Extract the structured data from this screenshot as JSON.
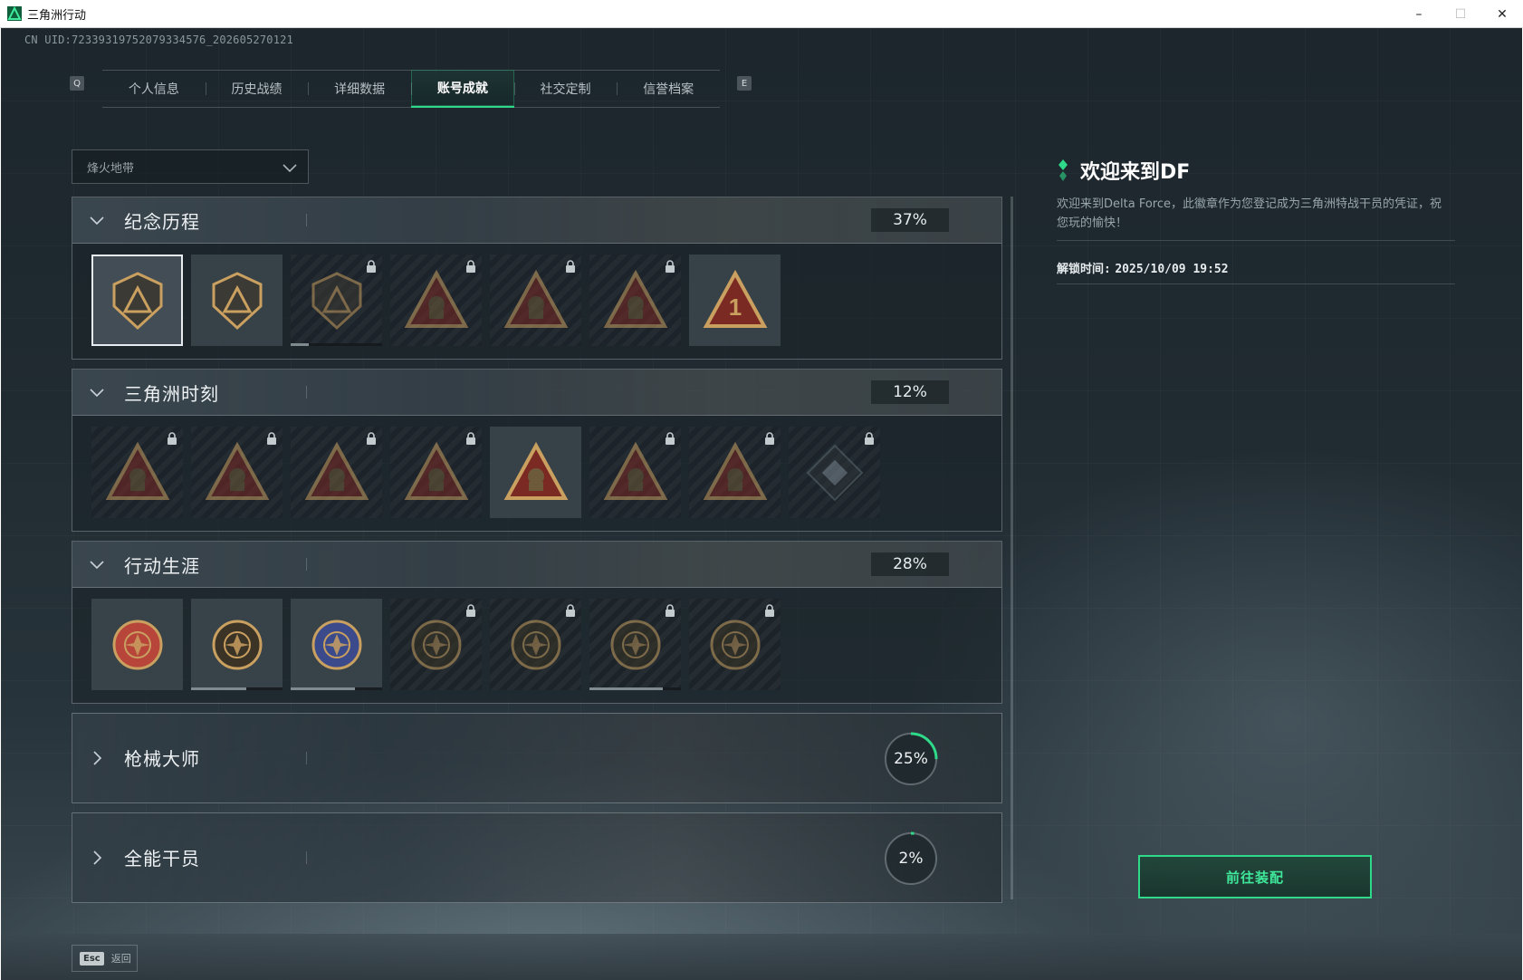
{
  "window": {
    "title": "三角洲行动",
    "controls": [
      "minimize",
      "maximize",
      "close"
    ]
  },
  "uid": "CN UID:7233931975207933457​6_202605270121",
  "tabs": {
    "left_key": "Q",
    "right_key": "E",
    "items": [
      {
        "label": "个人信息",
        "active": false
      },
      {
        "label": "历史战绩",
        "active": false
      },
      {
        "label": "详细数据",
        "active": false
      },
      {
        "label": "账号成就",
        "active": true
      },
      {
        "label": "社交定制",
        "active": false
      },
      {
        "label": "信誉档案",
        "active": false
      }
    ]
  },
  "mode_select": {
    "value": "烽火地带"
  },
  "sections": [
    {
      "title": "纪念历程",
      "percent": "37%",
      "expanded": true,
      "medals": [
        {
          "icon": "delta-triangle-shield-icon",
          "locked": false,
          "selected": true,
          "progress": 1
        },
        {
          "icon": "helicopter-shield-icon",
          "locked": false,
          "selected": false,
          "progress": 1
        },
        {
          "icon": "hex-shield-icon",
          "locked": true,
          "selected": false,
          "progress": 0.2
        },
        {
          "icon": "soldier-triangle-icon",
          "locked": true,
          "selected": false,
          "progress": 0
        },
        {
          "icon": "hooded-figure-triangle-icon",
          "locked": true,
          "selected": false,
          "progress": 0
        },
        {
          "icon": "crossed-rifles-triangle-icon",
          "locked": true,
          "selected": false,
          "progress": 0
        },
        {
          "icon": "number-one-triangle-icon",
          "locked": false,
          "selected": false,
          "progress": 1
        }
      ]
    },
    {
      "title": "三角洲时刻",
      "percent": "12%",
      "expanded": true,
      "medals": [
        {
          "icon": "robot-triangle-icon",
          "locked": true,
          "progress": 0
        },
        {
          "icon": "mask-triangle-icon",
          "locked": true,
          "progress": 0
        },
        {
          "icon": "rider-triangle-icon",
          "locked": true,
          "progress": 0
        },
        {
          "icon": "gear-triangle-icon",
          "locked": true,
          "progress": 0
        },
        {
          "icon": "squad-triangle-icon",
          "locked": false,
          "progress": 1
        },
        {
          "icon": "beast-triangle-icon",
          "locked": true,
          "progress": 0
        },
        {
          "icon": "fish-triangle-icon",
          "locked": true,
          "progress": 0
        },
        {
          "icon": "cube-diamond-icon",
          "locked": true,
          "progress": 0
        }
      ]
    },
    {
      "title": "行动生涯",
      "percent": "28%",
      "expanded": true,
      "medals": [
        {
          "icon": "star-badge-icon",
          "locked": false,
          "progress": 1
        },
        {
          "icon": "chevron-badge-icon",
          "locked": false,
          "progress": 0.6
        },
        {
          "icon": "police-badge-icon",
          "locked": false,
          "progress": 0.7
        },
        {
          "icon": "hex-badge-icon",
          "locked": true,
          "progress": 0
        },
        {
          "icon": "orb-badge-icon",
          "locked": true,
          "progress": 0
        },
        {
          "icon": "skull-target-icon",
          "locked": true,
          "progress": 0.8
        },
        {
          "icon": "eye-badge-icon",
          "locked": true,
          "progress": 0
        }
      ]
    },
    {
      "title": "枪械大师",
      "percent": "25%",
      "percent_value": 0.25,
      "expanded": false
    },
    {
      "title": "全能干员",
      "percent": "2%",
      "percent_value": 0.02,
      "expanded": false
    }
  ],
  "detail": {
    "title": "欢迎来到DF",
    "description": "欢迎来到Delta Force，此徽章作为您登记成为三角洲特战干员的凭证，祝您玩的愉快！",
    "unlock_label": "解锁时间:",
    "unlock_time": "2025/10/09 19:52"
  },
  "equip_button": "前往装配",
  "back": {
    "key": "Esc",
    "label": "返回"
  },
  "colors": {
    "accent": "#2fd98a",
    "medal_gold": "#c9a060",
    "medal_red": "#7a2a22"
  }
}
